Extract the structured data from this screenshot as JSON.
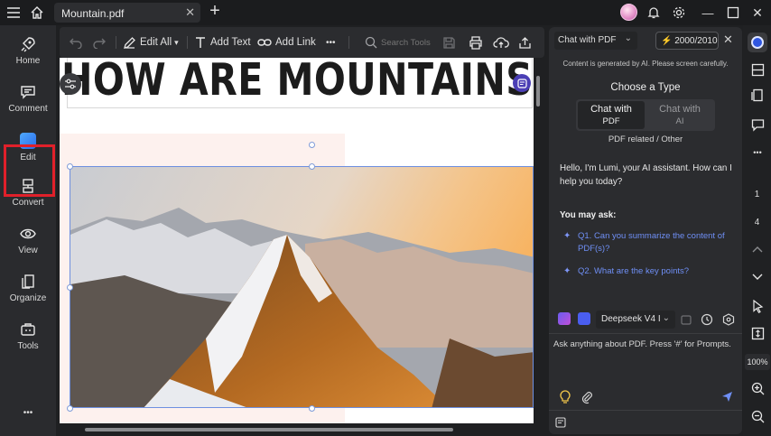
{
  "titlebar": {
    "tab_title": "Mountain.pdf",
    "tab_close": "✕",
    "add_tab": "+",
    "window_minimize": "—",
    "window_close": "✕"
  },
  "sidebar": {
    "items": [
      {
        "label": "Home",
        "icon": "rocket-icon"
      },
      {
        "label": "Comment",
        "icon": "comment-icon"
      },
      {
        "label": "Edit",
        "icon": "edit-icon"
      },
      {
        "label": "Convert",
        "icon": "convert-icon"
      },
      {
        "label": "View",
        "icon": "eye-icon"
      },
      {
        "label": "Organize",
        "icon": "organize-icon"
      },
      {
        "label": "Tools",
        "icon": "toolbox-icon"
      }
    ],
    "more": "•••",
    "highlight_color": "#e0202a"
  },
  "toolbar": {
    "edit_all": "Edit All",
    "add_text": "Add Text",
    "add_link": "Add Link",
    "more": "•••",
    "search_placeholder": "Search Tools"
  },
  "document": {
    "heading": "HOW ARE MOUNTAINS FORMED?"
  },
  "chat": {
    "mode": "Chat with PDF",
    "tokens": "2000/2010",
    "close": "✕",
    "notice": "Content is generated by AI. Please screen carefully.",
    "choose_type": "Choose a Type",
    "type_active": {
      "line1": "Chat with",
      "line2": "PDF"
    },
    "type_inactive": {
      "line1": "Chat with",
      "line2": "AI"
    },
    "related": "PDF related / Other",
    "greeting": "Hello, I'm Lumi, your AI assistant. How can I help you today?",
    "you_may_ask": "You may ask:",
    "questions": [
      "Q1. Can you summarize the content of PDF(s)?",
      "Q2. What are the key points?"
    ],
    "model": "Deepseek V4 I",
    "input_placeholder": "Ask anything about PDF. Press '#' for Prompts.",
    "accent_color": "#6f8ff5"
  },
  "rightrail": {
    "page_current": "1",
    "page_total": "4",
    "zoom": "100%"
  }
}
